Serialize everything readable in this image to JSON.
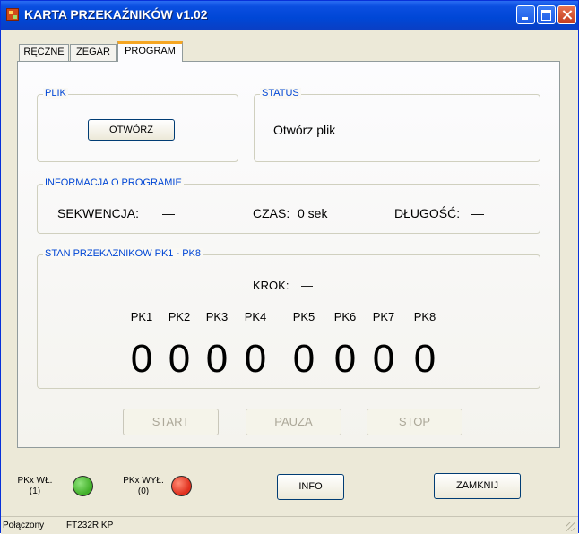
{
  "window": {
    "title": "KARTA PRZEKAŹNIKÓW v1.02"
  },
  "tabs": [
    {
      "label": "RĘCZNE",
      "active": false
    },
    {
      "label": "ZEGAR",
      "active": false
    },
    {
      "label": "PROGRAM",
      "active": true
    }
  ],
  "plik": {
    "label": "PLIK",
    "open_button": "OTWÓRZ"
  },
  "status_group": {
    "label": "STATUS",
    "text": "Otwórz plik"
  },
  "info_group": {
    "label": "INFORMACJA O PROGRAMIE",
    "sekwencja_label": "SEKWENCJA:",
    "sekwencja_value": "—",
    "czas_label": "CZAS:",
    "czas_value": "0 sek",
    "dlugosc_label": "DŁUGOŚĆ:",
    "dlugosc_value": "—"
  },
  "relays_group": {
    "label": "STAN PRZEKAZNIKOW PK1 - PK8",
    "step_label": "KROK:",
    "step_value": "—",
    "relays": [
      {
        "name": "PK1",
        "state": "0"
      },
      {
        "name": "PK2",
        "state": "0"
      },
      {
        "name": "PK3",
        "state": "0"
      },
      {
        "name": "PK4",
        "state": "0"
      },
      {
        "name": "PK5",
        "state": "0"
      },
      {
        "name": "PK6",
        "state": "0"
      },
      {
        "name": "PK7",
        "state": "0"
      },
      {
        "name": "PK8",
        "state": "0"
      }
    ]
  },
  "controls": {
    "start": "START",
    "pause": "PAUZA",
    "stop": "STOP"
  },
  "legend": {
    "on_label": "PKx WŁ.",
    "on_value": "(1)",
    "on_color": "#43b02a",
    "off_label": "PKx WYŁ.",
    "off_value": "(0)",
    "off_color": "#e0301e"
  },
  "footer_buttons": {
    "info": "INFO",
    "close": "ZAMKNIJ"
  },
  "statusbar": {
    "connection": "Połączony",
    "device": "FT232R KP"
  }
}
